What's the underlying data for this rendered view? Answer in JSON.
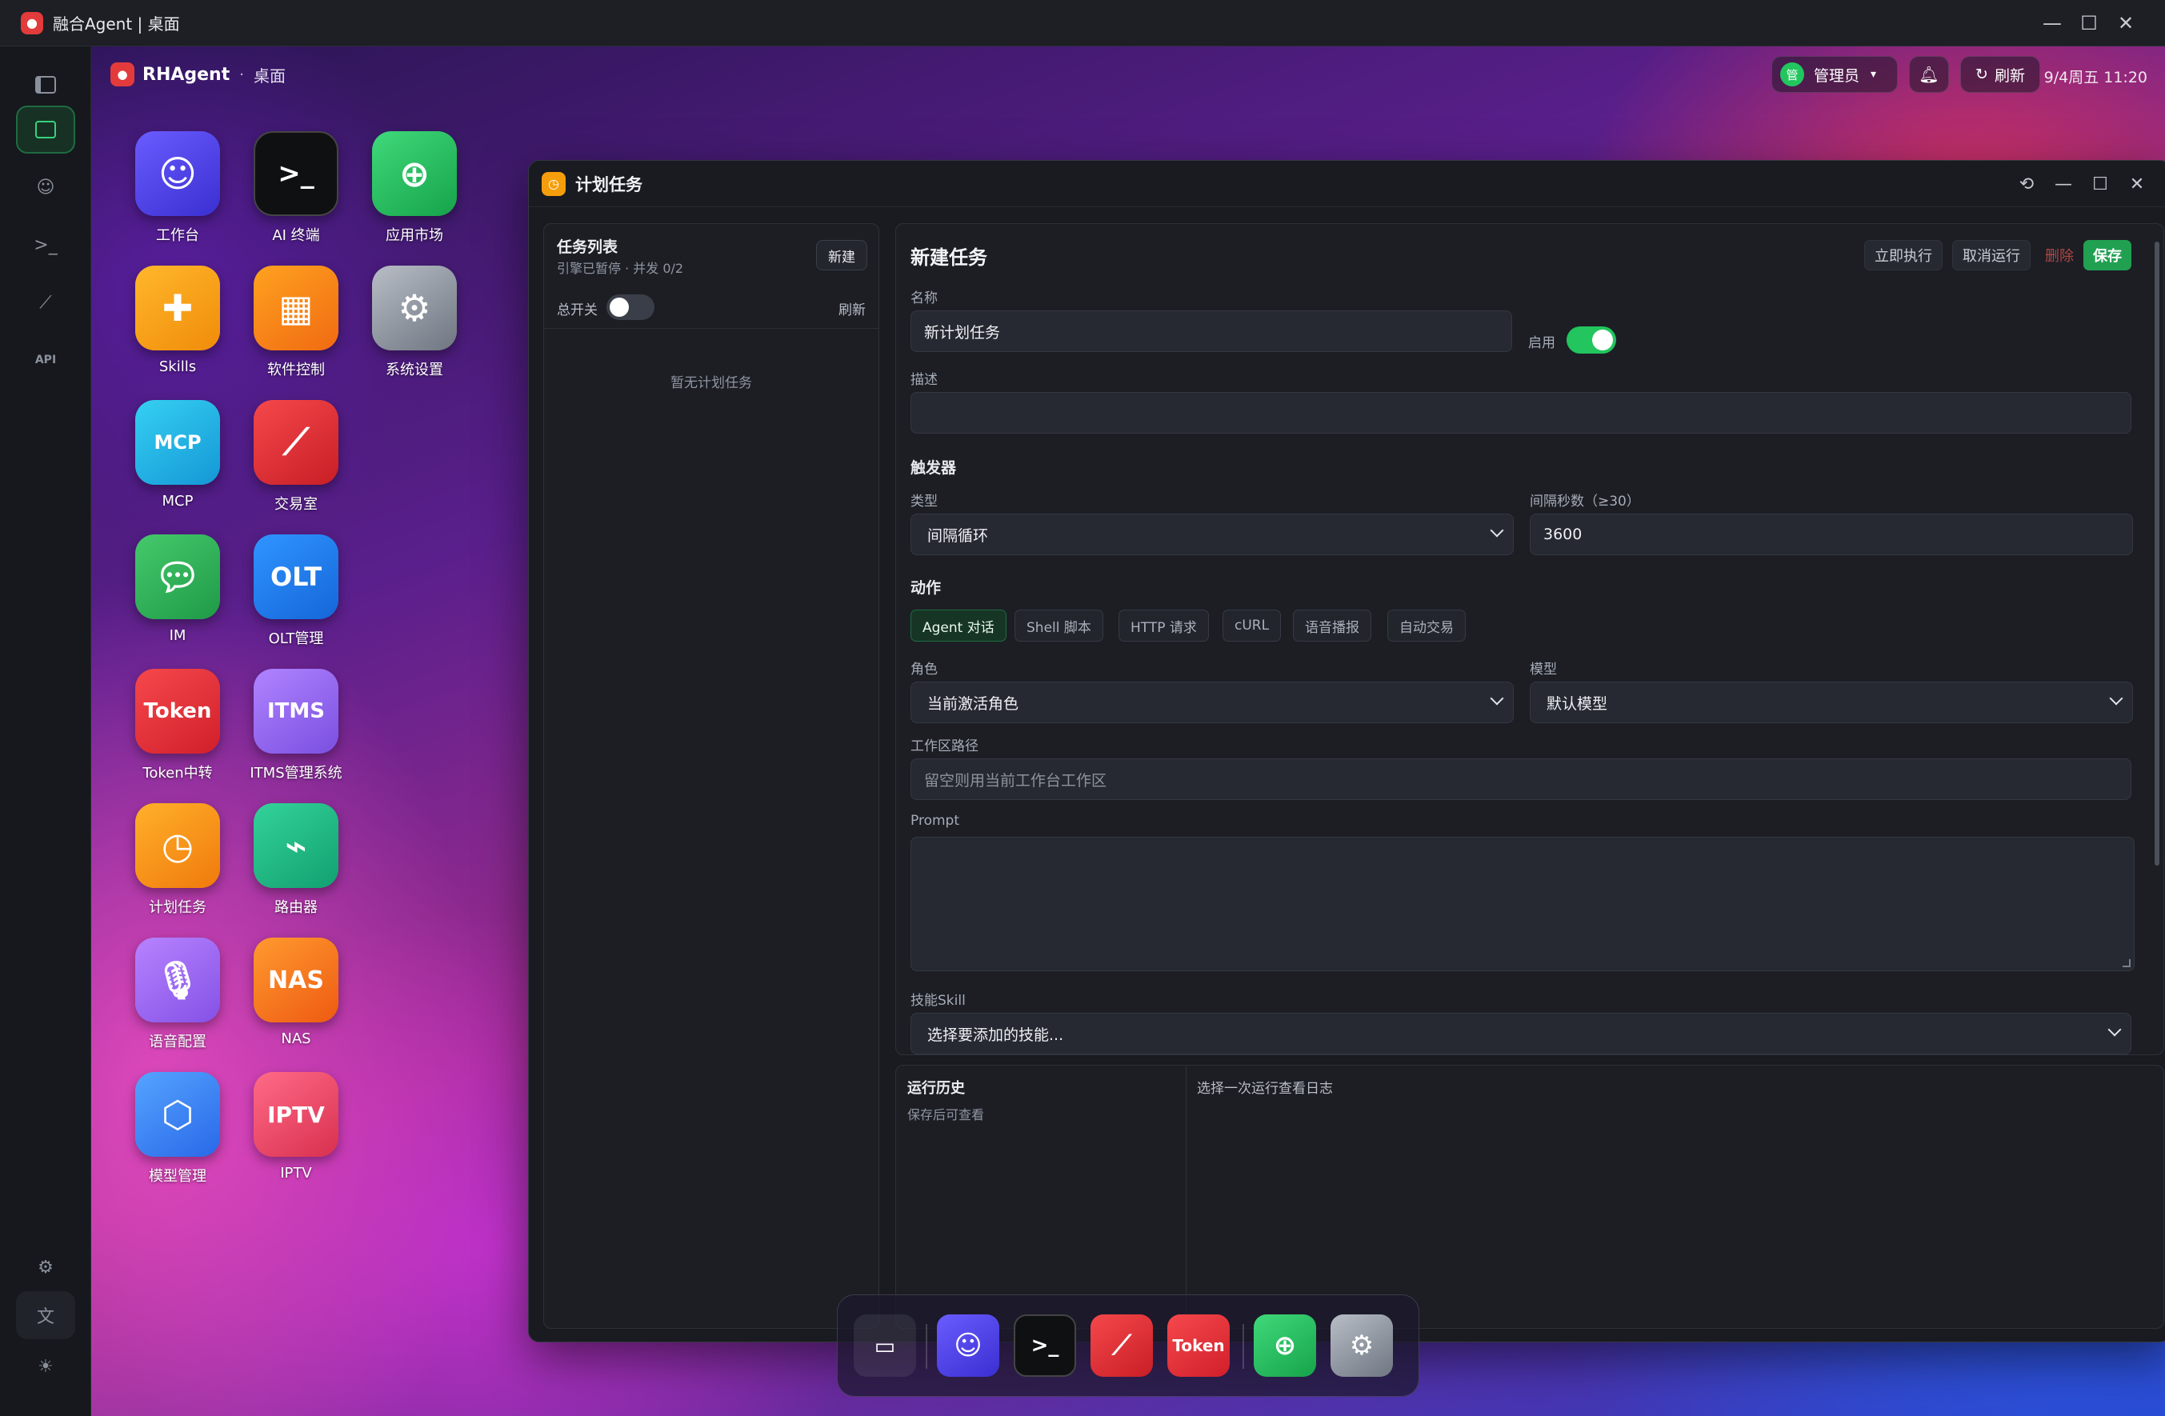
{
  "os": {
    "title": "融合Agent | 桌面"
  },
  "topbar": {
    "brand": "RHAgent",
    "crumb": "桌面",
    "user_badge": "管",
    "user_label": "管理员",
    "refresh_label": "刷新",
    "clock": "9/4周五 11:20"
  },
  "desktop_icons": [
    {
      "label": "工作台",
      "color": "#5b4df0"
    },
    {
      "label": "AI 终端",
      "color": "#111111"
    },
    {
      "label": "应用市场",
      "color": "#22c55e"
    },
    {
      "label": "Skills",
      "color": "#f59e0b"
    },
    {
      "label": "软件控制",
      "color": "#f97316"
    },
    {
      "label": "系统设置",
      "color": "#9ca3af"
    },
    {
      "label": "MCP",
      "color": "#22b8e6"
    },
    {
      "label": "交易室",
      "color": "#e5383b"
    },
    {
      "label": "IM",
      "color": "#2fb35b"
    },
    {
      "label": "OLT管理",
      "color": "#1d7ef0"
    },
    {
      "label": "Token中转",
      "color": "#e5383b"
    },
    {
      "label": "ITMS管理系统",
      "color": "#9b6cf2"
    },
    {
      "label": "计划任务",
      "color": "#f59e0b"
    },
    {
      "label": "路由器",
      "color": "#20b985"
    },
    {
      "label": "语音配置",
      "color": "#a26bf2"
    },
    {
      "label": "NAS",
      "color": "#f47b20"
    },
    {
      "label": "模型管理",
      "color": "#3d8ef5"
    },
    {
      "label": "IPTV",
      "color": "#ec4b6b"
    }
  ],
  "tile_texts": {
    "token": "Token",
    "olt": "OLT",
    "itms": "ITMS",
    "nas": "NAS",
    "iptv": "IPTV",
    "mcp": "MCP"
  },
  "window": {
    "title": "计划任务"
  },
  "tasklist": {
    "title": "任务列表",
    "subtitle": "引擎已暂停 · 并发 0/2",
    "new_label": "新建",
    "master_switch_label": "总开关",
    "refresh_label": "刷新",
    "empty_text": "暂无计划任务"
  },
  "editor": {
    "title": "新建任务",
    "run_now_label": "立即执行",
    "cancel_run_label": "取消运行",
    "delete_label": "删除",
    "save_label": "保存",
    "name_label": "名称",
    "name_value": "新计划任务",
    "enable_label": "启用",
    "desc_label": "描述",
    "desc_value": "",
    "trigger_section": "触发器",
    "type_label": "类型",
    "type_value": "间隔循环",
    "interval_label": "间隔秒数（≥30）",
    "interval_value": "3600",
    "action_section": "动作",
    "action_chips": [
      "Agent 对话",
      "Shell 脚本",
      "HTTP 请求",
      "cURL",
      "语音播报",
      "自动交易"
    ],
    "role_label": "角色",
    "role_value": "当前激活角色",
    "model_label": "模型",
    "model_value": "默认模型",
    "workspace_label": "工作区路径",
    "workspace_placeholder": "留空则用当前工作台工作区",
    "prompt_label": "Prompt",
    "skill_label": "技能Skill",
    "skill_value": "选择要添加的技能..."
  },
  "history": {
    "title": "运行历史",
    "subtitle": "保存后可查看",
    "log_placeholder": "选择一次运行查看日志"
  },
  "dock": {
    "items": [
      "desktop",
      "workbench",
      "ai-terminal",
      "trading",
      "token",
      "app-market",
      "settings"
    ],
    "token_label": "Token"
  }
}
